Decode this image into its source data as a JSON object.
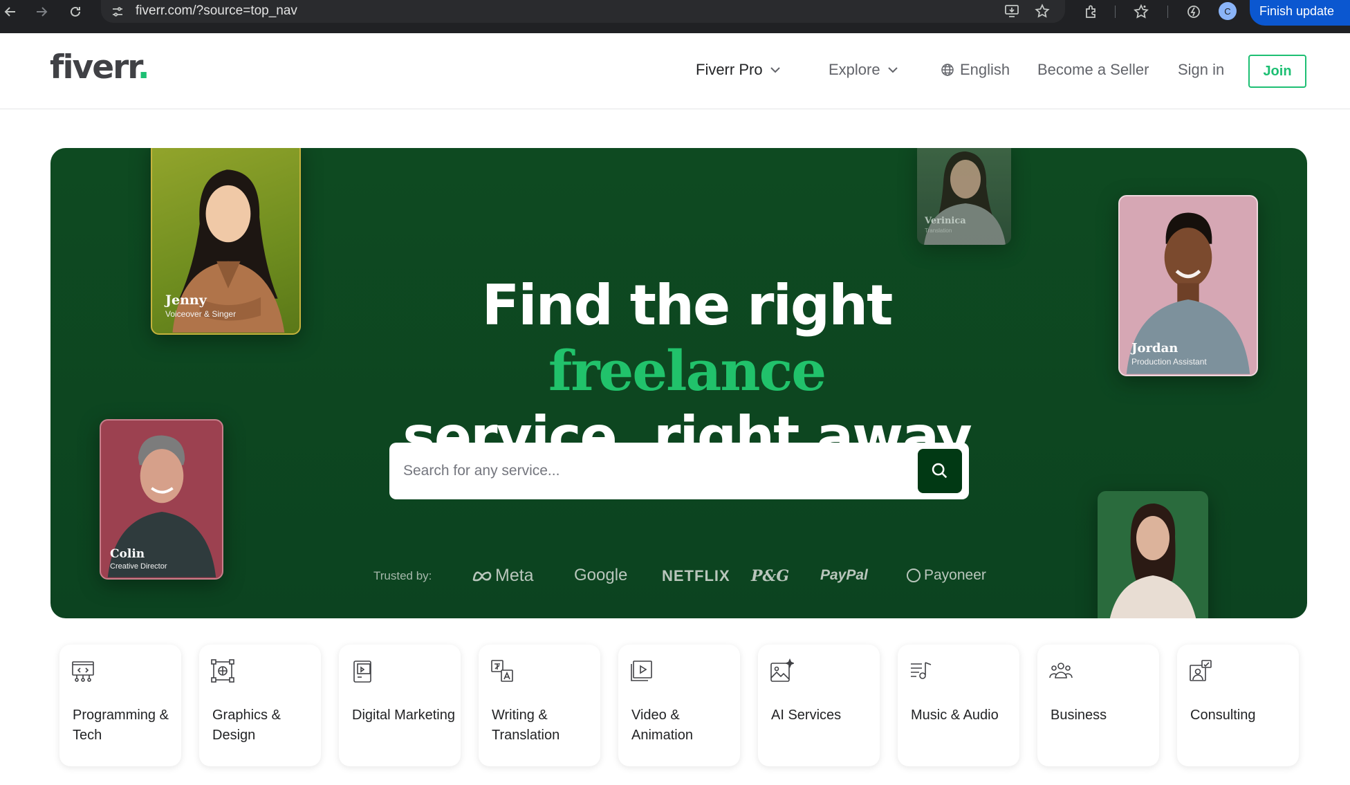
{
  "browser": {
    "url": "fiverr.com/?source=top_nav",
    "profile_initial": "C",
    "finish_update_label": "Finish update",
    "icons": [
      "back-icon",
      "forward-icon",
      "reload-icon",
      "site-settings-icon",
      "install-icon",
      "bookmark-star-icon",
      "extensions-icon",
      "bookmarks-icon",
      "performance-icon",
      "profile-avatar",
      "kebab-menu-icon"
    ]
  },
  "header": {
    "logo_text": "fiverr",
    "logo_dot": ".",
    "nav": {
      "fiverr_pro": "Fiverr Pro",
      "explore": "Explore",
      "language": "English",
      "become_seller": "Become a Seller",
      "sign_in": "Sign in",
      "join": "Join"
    }
  },
  "hero": {
    "title_part1": "Find the right ",
    "title_accent": "freelance",
    "title_part2": "service, right away",
    "search_placeholder": "Search for any service...",
    "trusted_label": "Trusted by:",
    "brands": [
      "Meta",
      "Google",
      "NETFLIX",
      "P&G",
      "PayPal",
      "Payoneer"
    ],
    "accent_color": "#1dbf73",
    "background_color": "#0e4a21",
    "freelancers": [
      {
        "name": "Jenny",
        "role": "Voiceover & Singer"
      },
      {
        "name": "Verinica",
        "role": "Translation"
      },
      {
        "name": "Jordan",
        "role": "Production Assistant"
      },
      {
        "name": "Colin",
        "role": "Creative Director"
      }
    ]
  },
  "categories": [
    {
      "label": "Programming & Tech",
      "icon": "monitor-code-icon"
    },
    {
      "label": "Graphics & Design",
      "icon": "design-frame-icon"
    },
    {
      "label": "Digital Marketing",
      "icon": "marketing-device-icon"
    },
    {
      "label": "Writing & Translation",
      "icon": "translate-icon"
    },
    {
      "label": "Video & Animation",
      "icon": "video-play-icon"
    },
    {
      "label": "AI Services",
      "icon": "ai-image-icon"
    },
    {
      "label": "Music & Audio",
      "icon": "music-list-icon"
    },
    {
      "label": "Business",
      "icon": "team-icon"
    },
    {
      "label": "Consulting",
      "icon": "consulting-icon"
    }
  ]
}
